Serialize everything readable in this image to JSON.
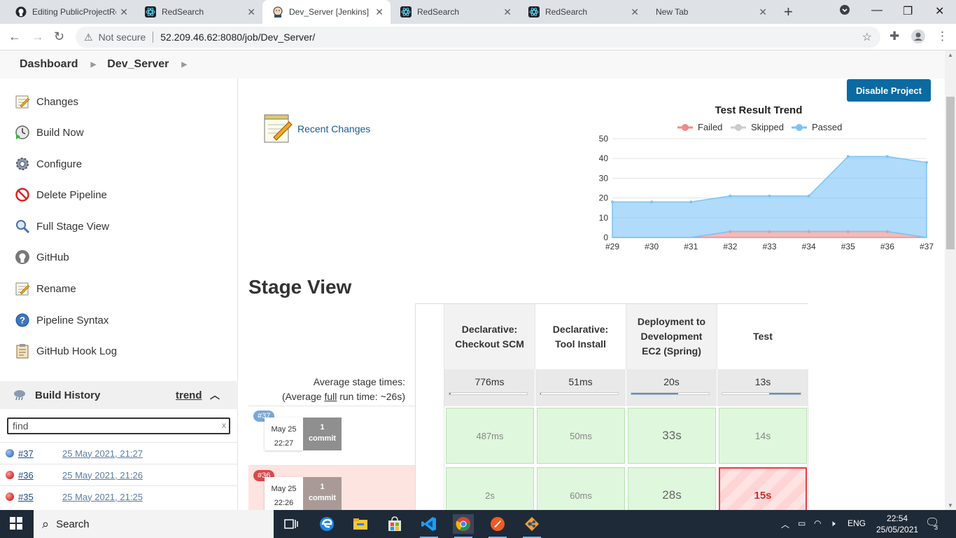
{
  "browser": {
    "tabs": [
      {
        "title": "Editing PublicProjectRe",
        "icon": "github-icon",
        "active": false
      },
      {
        "title": "RedSearch",
        "icon": "react-icon",
        "active": false
      },
      {
        "title": "Dev_Server [Jenkins]",
        "icon": "jenkins-icon",
        "active": true
      },
      {
        "title": "RedSearch",
        "icon": "react-icon",
        "active": false
      },
      {
        "title": "RedSearch",
        "icon": "react-icon",
        "active": false
      },
      {
        "title": "New Tab",
        "icon": "",
        "active": false
      }
    ],
    "security_label": "Not secure",
    "url": "52.209.46.62:8080/job/Dev_Server/"
  },
  "breadcrumb": {
    "items": [
      "Dashboard",
      "Dev_Server"
    ]
  },
  "sidebar": {
    "items": [
      {
        "label": "Changes",
        "icon": "notepad-icon"
      },
      {
        "label": "Build Now",
        "icon": "clock-play-icon"
      },
      {
        "label": "Configure",
        "icon": "gear-icon"
      },
      {
        "label": "Delete Pipeline",
        "icon": "no-entry-icon"
      },
      {
        "label": "Full Stage View",
        "icon": "magnifier-icon"
      },
      {
        "label": "GitHub",
        "icon": "github-icon"
      },
      {
        "label": "Rename",
        "icon": "notepad-icon"
      },
      {
        "label": "Pipeline Syntax",
        "icon": "help-icon"
      },
      {
        "label": "GitHub Hook Log",
        "icon": "clipboard-icon"
      }
    ]
  },
  "build_history": {
    "title": "Build History",
    "trend_label": "trend",
    "search_placeholder": "find",
    "builds": [
      {
        "number": "#37",
        "date": "25 May 2021, 21:27",
        "status": "blue"
      },
      {
        "number": "#36",
        "date": "25 May 2021, 21:26",
        "status": "red"
      },
      {
        "number": "#35",
        "date": "25 May 2021, 21:25",
        "status": "red"
      }
    ]
  },
  "main": {
    "disable_button": "Disable Project",
    "recent_changes": "Recent Changes",
    "stage_view_title": "Stage View"
  },
  "chart_data": {
    "type": "area",
    "title": "Test Result Trend",
    "x": [
      "#29",
      "#30",
      "#31",
      "#32",
      "#33",
      "#34",
      "#35",
      "#36",
      "#37"
    ],
    "series": [
      {
        "name": "Failed",
        "color": "#ef8a8a",
        "values": [
          0,
          0,
          0,
          3,
          3,
          3,
          3,
          3,
          0
        ]
      },
      {
        "name": "Skipped",
        "color": "#cccccc",
        "values": [
          0,
          0,
          0,
          0,
          0,
          0,
          0,
          0,
          0
        ]
      },
      {
        "name": "Passed",
        "color": "#7cc3f7",
        "values": [
          18,
          18,
          18,
          18,
          18,
          18,
          38,
          38,
          38
        ]
      }
    ],
    "ylim": [
      0,
      50
    ],
    "yticks": [
      0,
      10,
      20,
      30,
      40,
      50
    ],
    "stacked": true,
    "legend": "top",
    "grid": true
  },
  "stage_view": {
    "avg_label": "Average stage times:",
    "avg_full_prefix": "(Average ",
    "avg_full_word": "full",
    "avg_full_suffix": " run time: ~26s)",
    "stages": [
      {
        "name_line1": "Declarative:",
        "name_line2": "Checkout SCM",
        "name_line3": "",
        "avg": "776ms",
        "fill": 0.02,
        "fill_right": false
      },
      {
        "name_line1": "Declarative:",
        "name_line2": "Tool Install",
        "name_line3": "",
        "avg": "51ms",
        "fill": 0.01,
        "fill_right": false
      },
      {
        "name_line1": "Deployment to",
        "name_line2": "Development",
        "name_line3": "EC2 (Spring)",
        "avg": "20s",
        "fill": 0.6,
        "fill_right": false
      },
      {
        "name_line1": "Test",
        "name_line2": "",
        "name_line3": "",
        "avg": "13s",
        "fill": 0.4,
        "fill_right": true
      }
    ],
    "runs": [
      {
        "badge": "#37",
        "badge_color": "#7aa6d6",
        "date": "May 25",
        "time": "22:27",
        "commit_count": "1",
        "commit_label": "commit",
        "failed": false,
        "cells": [
          "487ms",
          "50ms",
          "33s",
          "14s"
        ],
        "failed_cells": [
          false,
          false,
          false,
          false
        ]
      },
      {
        "badge": "#36",
        "badge_color": "#d94a4a",
        "date": "May 25",
        "time": "22:26",
        "commit_count": "1",
        "commit_label": "commit",
        "failed": true,
        "cells": [
          "2s",
          "60ms",
          "28s",
          "15s"
        ],
        "failed_cells": [
          false,
          false,
          false,
          true
        ]
      }
    ]
  },
  "taskbar": {
    "search_label": "Search",
    "language": "ENG",
    "time": "22:54",
    "date": "25/05/2021",
    "notifications": "3"
  }
}
